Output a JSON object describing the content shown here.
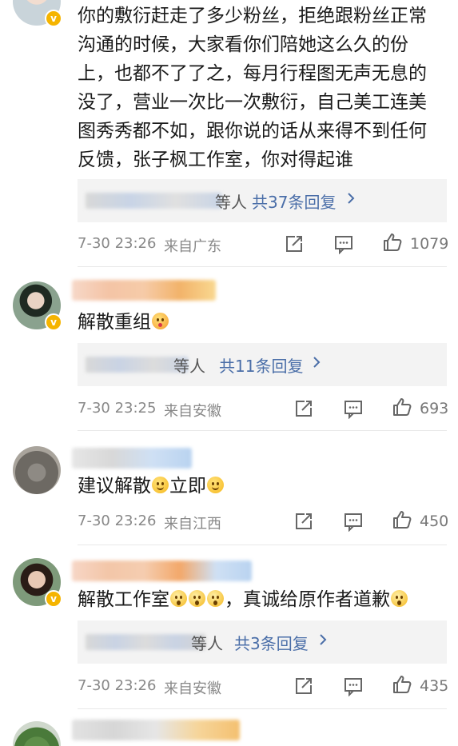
{
  "comments": [
    {
      "text_lines": [
        "你的敷衍赶走了多少粉丝，拒绝跟粉丝正常",
        "沟通的时候，大家看你们陪她这么久的份",
        "上，也都不了了之，每月行程图无声无息的",
        "没了，营业一次比一次敷衍，自己美工连美",
        "图秀秀都不如，跟你说的话从来得不到任何",
        "反馈，张子枫工作室，你对得起谁"
      ],
      "reply_suffix": "等人",
      "reply_count": "共37条回复",
      "timestamp": "7-30 23:26",
      "location": "来自广东",
      "likes": "1079"
    },
    {
      "text": "解散重组",
      "reply_suffix": "等人",
      "reply_count": "共11条回复",
      "timestamp": "7-30 23:25",
      "location": "来自安徽",
      "likes": "693"
    },
    {
      "text_a": "建议解散",
      "text_b": "立即",
      "timestamp": "7-30 23:26",
      "location": "来自江西",
      "likes": "450"
    },
    {
      "text_a": "解散工作室",
      "text_b": "，真诚给原作者道歉",
      "reply_suffix": "等人",
      "reply_count": "共3条回复",
      "timestamp": "7-30 23:26",
      "location": "来自安徽",
      "likes": "435"
    }
  ],
  "colors": {
    "reply_link": "#4a6ea8",
    "verified_badge": "#f5b400",
    "meta_text": "#888888"
  },
  "icons": [
    "share-icon",
    "comment-icon",
    "like-icon",
    "chevron-right-icon",
    "verified-badge-icon"
  ],
  "badge_symbol": "v"
}
